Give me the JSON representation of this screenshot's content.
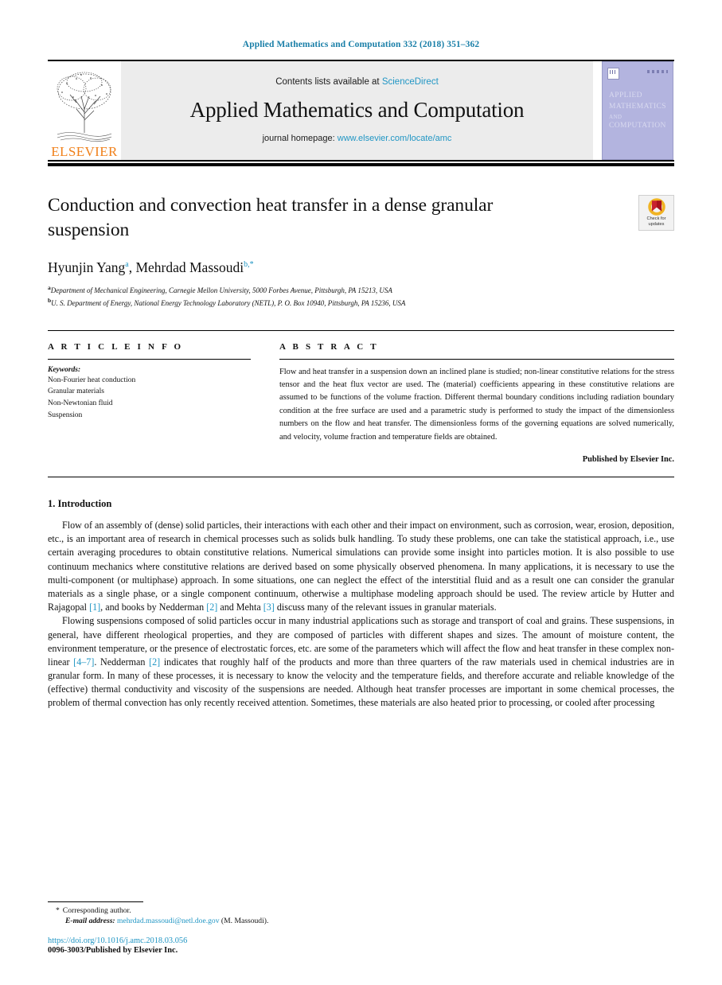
{
  "running_head": "Applied Mathematics and Computation 332 (2018) 351–362",
  "masthead": {
    "contents_prefix": "Contents lists available at",
    "contents_link": "ScienceDirect",
    "journal_title": "Applied Mathematics and Computation",
    "homepage_prefix": "journal homepage:",
    "homepage_link": "www.elsevier.com/locate/amc",
    "publisher_wordmark": "ELSEVIER",
    "cover": {
      "line1": "APPLIED",
      "line2": "MATHEMATICS",
      "line3": "AND",
      "line4": "COMPUTATION"
    }
  },
  "article": {
    "title": "Conduction and convection heat transfer in a dense granular suspension",
    "crossmark_label_line1": "Check for",
    "crossmark_label_line2": "updates",
    "authors": [
      {
        "name": "Hyunjin Yang",
        "marks": "a"
      },
      {
        "name": "Mehrdad Massoudi",
        "marks": "b,*"
      }
    ],
    "authors_separator": ", ",
    "affiliations": [
      {
        "mark": "a",
        "text": "Department of Mechanical Engineering, Carnegie Mellon University, 5000 Forbes Avenue, Pittsburgh, PA 15213, USA"
      },
      {
        "mark": "b",
        "text": "U. S. Department of Energy, National Energy Technology Laboratory (NETL), P. O. Box 10940, Pittsburgh, PA 15236, USA"
      }
    ]
  },
  "article_info": {
    "heading": "A R T I C L E   I N F O",
    "keywords_label": "Keywords:",
    "keywords": [
      "Non-Fourier heat conduction",
      "Granular materials",
      "Non-Newtonian fluid",
      "Suspension"
    ]
  },
  "abstract": {
    "heading": "A B S T R A C T",
    "text": "Flow and heat transfer in a suspension down an inclined plane is studied; non-linear constitutive relations for the stress tensor and the heat flux vector are used. The (material) coefficients appearing in these constitutive relations are assumed to be functions of the volume fraction. Different thermal boundary conditions including radiation boundary condition at the free surface are used and a parametric study is performed to study the impact of the dimensionless numbers on the flow and heat transfer. The dimensionless forms of the governing equations are solved numerically, and velocity, volume fraction and temperature fields are obtained.",
    "published_by": "Published by Elsevier Inc."
  },
  "body": {
    "section_heading": "1. Introduction",
    "paragraph1_a": "Flow of an assembly of (dense) solid particles, their interactions with each other and their impact on environment, such as corrosion, wear, erosion, deposition, etc., is an important area of research in chemical processes such as solids bulk handling. To study these problems, one can take the statistical approach, i.e., use certain averaging procedures to obtain constitutive relations. Numerical simulations can provide some insight into particles motion. It is also possible to use continuum mechanics where constitutive relations are derived based on some physically observed phenomena. In many applications, it is necessary to use the multi-component (or multiphase) approach. In some situations, one can neglect the effect of the interstitial fluid and as a result one can consider the granular materials as a single phase, or a single component continuum, otherwise a multiphase modeling approach should be used. The review article by Hutter and Rajagopal ",
    "paragraph1_cite1": "[1]",
    "paragraph1_b": ", and books by Nedderman ",
    "paragraph1_cite2": "[2]",
    "paragraph1_c": " and Mehta ",
    "paragraph1_cite3": "[3]",
    "paragraph1_d": " discuss many of the relevant issues in granular materials.",
    "paragraph2_a": "Flowing suspensions composed of solid particles occur in many industrial applications such as storage and transport of coal and grains. These suspensions, in general, have different rheological properties, and they are composed of particles with different shapes and sizes. The amount of moisture content, the environment temperature, or the presence of electrostatic forces, etc. are some of the parameters which will affect the flow and heat transfer in these complex non-linear ",
    "paragraph2_cite1": "[4–7]",
    "paragraph2_b": ". Nedderman ",
    "paragraph2_cite2": "[2]",
    "paragraph2_c": " indicates that roughly half of the products and more than three quarters of the raw materials used in chemical industries are in granular form. In many of these processes, it is necessary to know the velocity and the temperature fields, and therefore accurate and reliable knowledge of the (effective) thermal conductivity and viscosity of the suspensions are needed. Although heat transfer processes are important in some chemical processes, the problem of thermal convection has only recently received attention. Sometimes, these materials are also heated prior to processing, or cooled after processing"
  },
  "footer": {
    "corresponding_star": "*",
    "corresponding_text": "Corresponding author.",
    "email_label": "E-mail address:",
    "email": "mehrdad.massoudi@netl.doe.gov",
    "email_owner": "(M. Massoudi).",
    "doi": "https://doi.org/10.1016/j.amc.2018.03.056",
    "issn_line": "0096-3003/Published by Elsevier Inc."
  },
  "colors": {
    "link": "#2196c4",
    "running_head": "#1a7fa8",
    "elsevier_orange": "#f0801a",
    "cover_bg": "#b3b4df"
  }
}
